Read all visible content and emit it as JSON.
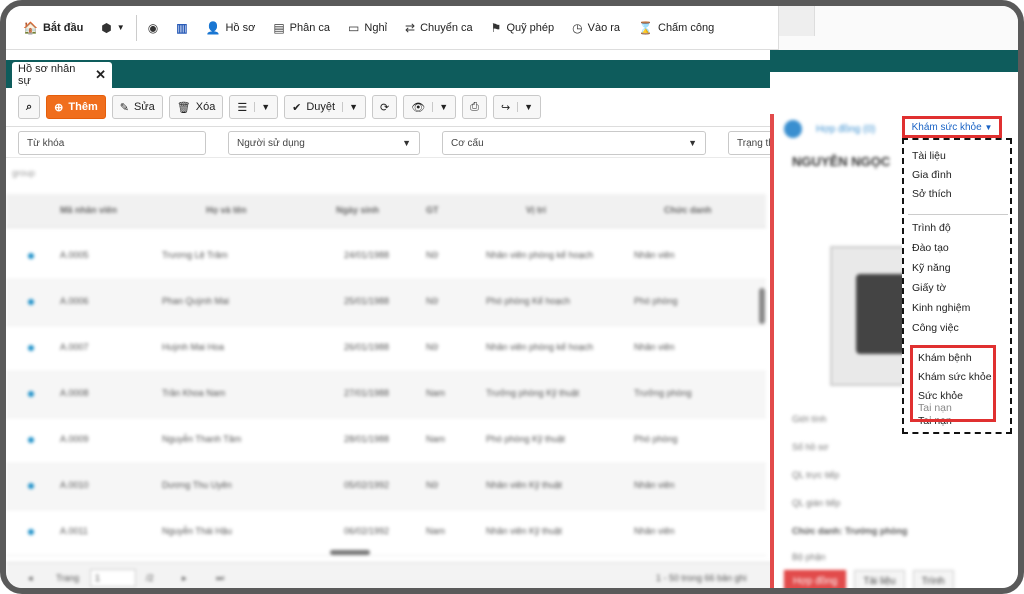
{
  "topmenu": {
    "items": [
      {
        "label": "Bắt đầu",
        "icon": "home-icon"
      },
      {
        "label": "",
        "icon": "box-icon"
      },
      {
        "label": "",
        "icon": "dashboard-icon"
      },
      {
        "label": "",
        "icon": "chart-icon"
      },
      {
        "label": "Hồ sơ",
        "icon": "user-icon"
      },
      {
        "label": "Phân ca",
        "icon": "list-icon"
      },
      {
        "label": "Nghỉ",
        "icon": "card-icon"
      },
      {
        "label": "Chuyển ca",
        "icon": "swap-icon"
      },
      {
        "label": "Quỹ phép",
        "icon": "flag-icon"
      },
      {
        "label": "Vào ra",
        "icon": "clock-icon"
      },
      {
        "label": "Chấm công",
        "icon": "hourglass-icon"
      }
    ]
  },
  "tab": {
    "label": "Hồ sơ nhân sự",
    "close": "✕"
  },
  "toolbar": {
    "add_label": "Thêm",
    "edit_label": "Sửa",
    "delete_label": "Xóa",
    "approve_label": "Duyệt"
  },
  "filters": {
    "keyword_placeholder": "Từ khóa",
    "user_placeholder": "Người sử dụng",
    "structure_placeholder": "Cơ cấu",
    "status_placeholder": "Trạng th"
  },
  "grid": {
    "group_label": "group",
    "columns": [
      "Mã nhân viên",
      "Họ và tên",
      "Ngày sinh",
      "GT",
      "Vị trí",
      "Chức danh"
    ],
    "rows": [
      [
        "A.0005",
        "Trương Lệ Trâm",
        "24/01/1988",
        "Nữ",
        "Nhân viên phòng kế hoạch",
        "Nhân viên"
      ],
      [
        "A.0006",
        "Phan Quỳnh Mai",
        "25/01/1988",
        "Nữ",
        "Phó phòng Kế hoạch",
        "Phó phòng"
      ],
      [
        "A.0007",
        "Huỳnh Mai Hoa",
        "26/01/1988",
        "Nữ",
        "Nhân viên phòng kế hoạch",
        "Nhân viên"
      ],
      [
        "A.0008",
        "Trần Khoa Nam",
        "27/01/1988",
        "Nam",
        "Trưởng phòng Kỹ thuật",
        "Trưởng phòng"
      ],
      [
        "A.0009",
        "Nguyễn Thanh Tâm",
        "28/01/1988",
        "Nam",
        "Phó phòng Kỹ thuật",
        "Phó phòng"
      ],
      [
        "A.0010",
        "Dương Thu Uyên",
        "05/02/1992",
        "Nữ",
        "Nhân viên Kỹ thuật",
        "Nhân viên"
      ],
      [
        "A.0011",
        "Nguyễn Thái Hậu",
        "06/02/1992",
        "Nam",
        "Nhân viên Kỹ thuật",
        "Nhân viên"
      ]
    ],
    "pager": {
      "page_label": "Trang",
      "page": "1",
      "of": "/2",
      "summary": "1 - 50 trong 66 bản ghi"
    }
  },
  "right_panel": {
    "contract_tab": "Hợp đồng (0)",
    "name": "NGUYỄN NGỌC",
    "info_lines": [
      "Giới tính",
      "Số hồ sơ",
      "QL trực tiếp",
      "QL gián tiếp",
      "Chức danh: Trưởng phòng",
      "Bộ phận"
    ],
    "buttons": [
      "Hợp đồng",
      "Tài liệu",
      "Trình"
    ]
  },
  "dropdown": {
    "trigger": "Khám sức khỏe",
    "group1": [
      "Tài liệu",
      "Gia đình",
      "Sở thích"
    ],
    "group2": [
      "Trình độ",
      "Đào tạo",
      "Kỹ năng",
      "Giấy tờ",
      "Kinh nghiệm",
      "Công việc"
    ],
    "group3": [
      "Khám bệnh",
      "Khám sức khỏe",
      "Sức khỏe",
      "Tai nạn"
    ],
    "group3_shadow": "Tai nạn"
  },
  "colors": {
    "teal": "#0e5c5c",
    "orange": "#f06e1d",
    "highlight": "#e03030",
    "link": "#1a63c5"
  }
}
